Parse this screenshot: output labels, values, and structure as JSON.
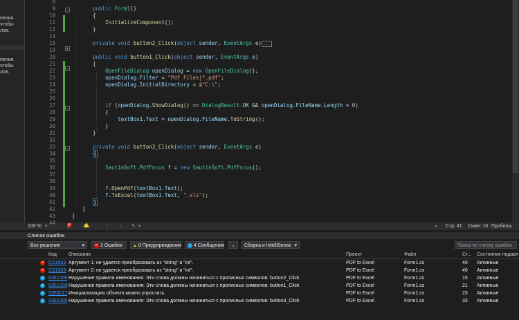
{
  "left_panel": {
    "block1": [
      "пения.",
      "чтобы",
      "лов."
    ],
    "block2": [
      "пения.",
      "чтобы",
      "лов."
    ]
  },
  "code_lines": [
    {
      "n": "8",
      "tokens": []
    },
    {
      "n": "9",
      "tokens": [
        {
          "c": "k",
          "t": "public "
        },
        {
          "c": "t",
          "t": "Form1"
        },
        {
          "c": "p",
          "t": "()"
        }
      ]
    },
    {
      "n": "10",
      "tokens": [
        {
          "c": "p",
          "t": "{"
        }
      ]
    },
    {
      "n": "11",
      "tokens": [
        {
          "c": "p",
          "t": "    "
        },
        {
          "c": "m",
          "t": "InitializeComponent"
        },
        {
          "c": "p",
          "t": "();"
        }
      ]
    },
    {
      "n": "12",
      "tokens": [
        {
          "c": "p",
          "t": "}"
        }
      ]
    },
    {
      "n": "14",
      "tokens": []
    },
    {
      "n": "15",
      "tokens": [
        {
          "c": "k",
          "t": "private void "
        },
        {
          "c": "m",
          "t": "button2_Click"
        },
        {
          "c": "p",
          "t": "("
        },
        {
          "c": "k",
          "t": "object "
        },
        {
          "c": "v",
          "t": "sender"
        },
        {
          "c": "p",
          "t": ", "
        },
        {
          "c": "t",
          "t": "EventArgs "
        },
        {
          "c": "v",
          "t": "e"
        },
        {
          "c": "p",
          "t": ")"
        },
        {
          "c": "collapsed",
          "t": "..."
        }
      ]
    },
    {
      "n": "19",
      "tokens": []
    },
    {
      "n": "20",
      "tokens": [
        {
          "c": "k",
          "t": "public void "
        },
        {
          "c": "m",
          "t": "button1_Click"
        },
        {
          "c": "p",
          "t": "("
        },
        {
          "c": "k",
          "t": "object "
        },
        {
          "c": "v",
          "t": "sender"
        },
        {
          "c": "p",
          "t": ", "
        },
        {
          "c": "t",
          "t": "EventArgs "
        },
        {
          "c": "v",
          "t": "e"
        },
        {
          "c": "p",
          "t": ")"
        }
      ]
    },
    {
      "n": "21",
      "tokens": [
        {
          "c": "p",
          "t": "{"
        }
      ]
    },
    {
      "n": "22",
      "tokens": [
        {
          "c": "p",
          "t": "    "
        },
        {
          "c": "t",
          "t": "OpenFileDialog "
        },
        {
          "c": "v",
          "t": "openDialog"
        },
        {
          "c": "p",
          "t": " = "
        },
        {
          "c": "k",
          "t": "new "
        },
        {
          "c": "t",
          "t": "OpenFileDialog"
        },
        {
          "c": "p",
          "t": "();"
        }
      ]
    },
    {
      "n": "23",
      "tokens": [
        {
          "c": "p",
          "t": "    "
        },
        {
          "c": "v",
          "t": "openDialog"
        },
        {
          "c": "p",
          "t": "."
        },
        {
          "c": "v",
          "t": "Filter"
        },
        {
          "c": "p",
          "t": " = "
        },
        {
          "c": "s",
          "t": "\"Pdf Files|*.pdf\""
        },
        {
          "c": "p",
          "t": ";"
        }
      ]
    },
    {
      "n": "24",
      "tokens": [
        {
          "c": "p",
          "t": "    "
        },
        {
          "c": "v",
          "t": "openDialog"
        },
        {
          "c": "p",
          "t": "."
        },
        {
          "c": "v",
          "t": "InitialDirectory"
        },
        {
          "c": "p",
          "t": " = "
        },
        {
          "c": "s",
          "t": "@\"C:\\\""
        },
        {
          "c": "p",
          "t": ";"
        }
      ]
    },
    {
      "n": "25",
      "tokens": []
    },
    {
      "n": "26",
      "tokens": []
    },
    {
      "n": "27",
      "tokens": [
        {
          "c": "p",
          "t": "    "
        },
        {
          "c": "k",
          "t": "if "
        },
        {
          "c": "p",
          "t": "("
        },
        {
          "c": "v",
          "t": "openDialog"
        },
        {
          "c": "p",
          "t": "."
        },
        {
          "c": "m",
          "t": "ShowDialog"
        },
        {
          "c": "p",
          "t": "() == "
        },
        {
          "c": "t",
          "t": "DialogResult"
        },
        {
          "c": "p",
          "t": "."
        },
        {
          "c": "v",
          "t": "OK"
        },
        {
          "c": "p",
          "t": " && "
        },
        {
          "c": "v",
          "t": "openDialog"
        },
        {
          "c": "p",
          "t": "."
        },
        {
          "c": "v",
          "t": "FileName"
        },
        {
          "c": "p",
          "t": "."
        },
        {
          "c": "v",
          "t": "Length"
        },
        {
          "c": "p",
          "t": " > "
        },
        {
          "c": "n",
          "t": "0"
        },
        {
          "c": "p",
          "t": ")"
        }
      ]
    },
    {
      "n": "28",
      "tokens": [
        {
          "c": "p",
          "t": "    {"
        }
      ]
    },
    {
      "n": "29",
      "tokens": [
        {
          "c": "p",
          "t": "        "
        },
        {
          "c": "v",
          "t": "textBox1"
        },
        {
          "c": "p",
          "t": "."
        },
        {
          "c": "v",
          "t": "Text"
        },
        {
          "c": "p",
          "t": " = "
        },
        {
          "c": "v",
          "t": "openDialog"
        },
        {
          "c": "p",
          "t": "."
        },
        {
          "c": "v",
          "t": "FileName"
        },
        {
          "c": "p",
          "t": "."
        },
        {
          "c": "m",
          "t": "ToString"
        },
        {
          "c": "p",
          "t": "();"
        }
      ]
    },
    {
      "n": "30",
      "tokens": [
        {
          "c": "p",
          "t": "    }"
        }
      ]
    },
    {
      "n": "31",
      "tokens": [
        {
          "c": "p",
          "t": "}"
        }
      ]
    },
    {
      "n": "32",
      "tokens": []
    },
    {
      "n": "33",
      "tokens": [
        {
          "c": "k",
          "t": "private void "
        },
        {
          "c": "m",
          "t": "button3_Click"
        },
        {
          "c": "p",
          "t": "("
        },
        {
          "c": "k",
          "t": "object "
        },
        {
          "c": "v",
          "t": "sender"
        },
        {
          "c": "p",
          "t": ", "
        },
        {
          "c": "t",
          "t": "EventArgs "
        },
        {
          "c": "v",
          "t": "e"
        },
        {
          "c": "p",
          "t": ")"
        }
      ]
    },
    {
      "n": "34",
      "tokens": [
        {
          "c": "cursorbox",
          "t": "{"
        }
      ]
    },
    {
      "n": "35",
      "tokens": []
    },
    {
      "n": "36",
      "tokens": [
        {
          "c": "p",
          "t": "    "
        },
        {
          "c": "t",
          "t": "SautinSoft"
        },
        {
          "c": "p",
          "t": "."
        },
        {
          "c": "t",
          "t": "PdfFocus "
        },
        {
          "c": "v",
          "t": "f"
        },
        {
          "c": "p",
          "t": " = "
        },
        {
          "c": "k",
          "t": "new "
        },
        {
          "c": "t",
          "t": "SautinSoft"
        },
        {
          "c": "p",
          "t": "."
        },
        {
          "c": "t",
          "t": "PdfFocus"
        },
        {
          "c": "p",
          "t": "();"
        }
      ]
    },
    {
      "n": "37",
      "tokens": []
    },
    {
      "n": "38",
      "tokens": []
    },
    {
      "n": "39",
      "tokens": [
        {
          "c": "p",
          "t": "    "
        },
        {
          "c": "v",
          "t": "f"
        },
        {
          "c": "p",
          "t": "."
        },
        {
          "c": "m",
          "t": "OpenPdf"
        },
        {
          "c": "p",
          "t": "("
        },
        {
          "c": "v",
          "t": "textBox1"
        },
        {
          "c": "p",
          "t": "."
        },
        {
          "c": "v",
          "t": "Text"
        },
        {
          "c": "p",
          "t": ");"
        }
      ]
    },
    {
      "n": "40",
      "tokens": [
        {
          "c": "p",
          "t": "    "
        },
        {
          "c": "v",
          "t": "f"
        },
        {
          "c": "p",
          "t": "."
        },
        {
          "c": "m",
          "t": "ToExcel"
        },
        {
          "c": "p",
          "t": "("
        },
        {
          "c": "v",
          "t": "textBox1"
        },
        {
          "c": "p",
          "t": "."
        },
        {
          "c": "v",
          "t": "Text"
        },
        {
          "c": "p",
          "t": ", "
        },
        {
          "c": "s",
          "t": "\".xls\""
        },
        {
          "c": "p",
          "t": ");"
        }
      ]
    },
    {
      "n": "41",
      "tokens": [
        {
          "c": "cursorbox",
          "t": "}"
        }
      ]
    },
    {
      "n": "42",
      "tokens": [
        {
          "c": "p",
          "t": "}"
        }
      ]
    },
    {
      "n": "43",
      "tokens": [
        {
          "c": "p",
          "t": "}"
        }
      ]
    },
    {
      "n": "44",
      "tokens": []
    }
  ],
  "status_bar": {
    "zoom": "100 %",
    "errors": "2",
    "warnings": "0",
    "line": "Стр: 41",
    "col": "Симв: 10",
    "spaces": "Пробелы"
  },
  "error_list": {
    "title": "Список ошибок",
    "scope": "Все решение",
    "errors_btn": "2 Ошибки",
    "warnings_btn": "0 Предупреждения",
    "messages_btn": "4 Сообщения",
    "build_filter": "Сборка и IntelliSense",
    "search_placeholder": "Поиск по списку ошибок",
    "headers": {
      "code": "Код",
      "desc": "Описание",
      "project": "Проект",
      "file": "Файл",
      "line": "Ст...",
      "state": "Состояние подавл..."
    },
    "rows": [
      {
        "kind": "error",
        "code": "CS1503",
        "desc": "Аргумент 1: не удается преобразовать из \"string\" в \"int\".",
        "project": "PDF to Excel",
        "file": "Form1.cs",
        "line": "40",
        "state": "Активные"
      },
      {
        "kind": "error",
        "code": "CS1503",
        "desc": "Аргумент 2: не удается преобразовать из \"string\" в \"int\".",
        "project": "PDF to Excel",
        "file": "Form1.cs",
        "line": "40",
        "state": "Активные"
      },
      {
        "kind": "info",
        "code": "IDE1006",
        "desc": "Нарушение правила именования: Эти слова должны начинаться с прописных символов: button2_Click",
        "project": "PDF to Excel",
        "file": "Form1.cs",
        "line": "15",
        "state": "Активные"
      },
      {
        "kind": "info",
        "code": "IDE1006",
        "desc": "Нарушение правила именования: Эти слова должны начинаться с прописных символов: button1_Click",
        "project": "PDF to Excel",
        "file": "Form1.cs",
        "line": "21",
        "state": "Активные"
      },
      {
        "kind": "info",
        "code": "IDE0017",
        "desc": "Инициализацию объекта можно упростить.",
        "project": "PDF to Excel",
        "file": "Form1.cs",
        "line": "23",
        "state": "Активные"
      },
      {
        "kind": "info",
        "code": "IDE1006",
        "desc": "Нарушение правила именования: Эти слова должны начинаться с прописных символов: button3_Click",
        "project": "PDF to Excel",
        "file": "Form1.cs",
        "line": "33",
        "state": "Активные"
      }
    ]
  }
}
